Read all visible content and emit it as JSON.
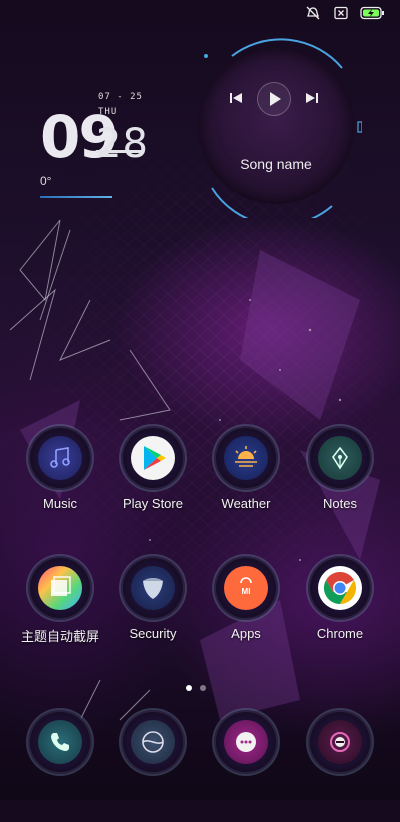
{
  "status_bar": {
    "icons": [
      "do-not-disturb-icon",
      "sim-off-icon",
      "battery-charging-icon"
    ],
    "accent": "#7dff5a"
  },
  "clock": {
    "hour": "09",
    "minute": "28",
    "date": "07 - 25",
    "day": "THU",
    "temperature": "0°"
  },
  "music_widget": {
    "song_name": "Song name",
    "controls": [
      "previous-icon",
      "play-icon",
      "next-icon"
    ]
  },
  "apps": [
    {
      "label": "Music",
      "icon": "music-note-icon"
    },
    {
      "label": "Play Store",
      "icon": "play-store-icon"
    },
    {
      "label": "Weather",
      "icon": "weather-sunrise-icon"
    },
    {
      "label": "Notes",
      "icon": "pen-nib-icon"
    },
    {
      "label": "主题自动截屏",
      "icon": "theme-screenshot-icon"
    },
    {
      "label": "Security",
      "icon": "shield-icon"
    },
    {
      "label": "Apps",
      "icon": "mi-shopping-bag-icon"
    },
    {
      "label": "Chrome",
      "icon": "chrome-icon"
    }
  ],
  "dock": [
    {
      "icon": "phone-icon"
    },
    {
      "icon": "browser-icon"
    },
    {
      "icon": "messaging-icon"
    },
    {
      "icon": "camera-icon"
    }
  ],
  "pager": {
    "pages": 2,
    "current": 1
  },
  "colors": {
    "accent_blue": "#4aa3e0",
    "wallpaper_purple": "#8a2aa0"
  }
}
